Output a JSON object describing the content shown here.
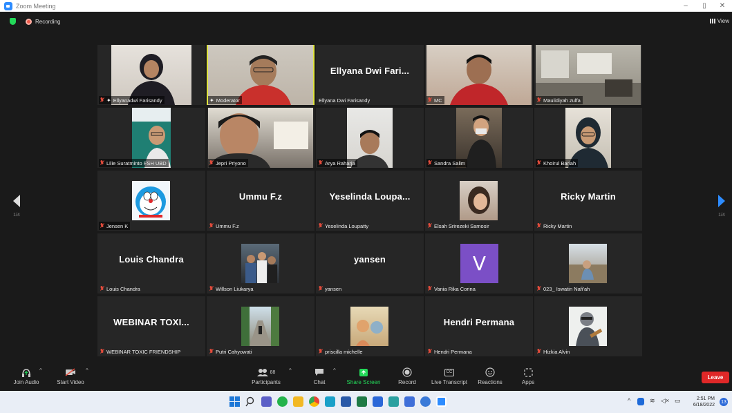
{
  "window": {
    "title": "Zoom Meeting",
    "minimize": "–",
    "restore": "▯",
    "close": "✕"
  },
  "meeting": {
    "recording_label": "Recording",
    "view_label": "View",
    "page_left": "1/4",
    "page_right": "1/4"
  },
  "tiles": [
    {
      "name": "Ellyanadwi Farisandy",
      "type": "video",
      "bg": "#d9d6d2"
    },
    {
      "name": "Moderator",
      "type": "video",
      "bg": "#c9c2b8",
      "pinned": true
    },
    {
      "name": "Ellyana Dwi Farisandy",
      "type": "text",
      "display": "Ellyana  Dwi  Fari..."
    },
    {
      "name": "MC",
      "type": "video",
      "bg": "#c9b5a8"
    },
    {
      "name": "Maulidiyah zulfa",
      "type": "video",
      "bg": "#a7a69c"
    },
    {
      "name": "Lilie Suratminto FSH UBD",
      "type": "video",
      "bg": "#2c2c2c"
    },
    {
      "name": "Jepri Priyono",
      "type": "video",
      "bg": "#6c6660"
    },
    {
      "name": "Arya Raharja",
      "type": "video",
      "bg": "#1f1f1f"
    },
    {
      "name": "Sandra Salim",
      "type": "video",
      "bg": "#3d3a36"
    },
    {
      "name": "Khoirul Bariah",
      "type": "video",
      "bg": "#2b2b2b"
    },
    {
      "name": "Jensen K",
      "type": "video",
      "bg": "#262626"
    },
    {
      "name": "Ummu F.z",
      "type": "text",
      "display": "Ummu F.z"
    },
    {
      "name": "Yeselinda Loupatty",
      "type": "text",
      "display": "Yeselinda  Loupa..."
    },
    {
      "name": "Elsah Srirezeki Samosir",
      "type": "video",
      "bg": "#262626"
    },
    {
      "name": "Ricky Martin",
      "type": "text",
      "display": "Ricky Martin"
    },
    {
      "name": "Louis Chandra",
      "type": "text",
      "display": "Louis Chandra"
    },
    {
      "name": "Willson Liukarya",
      "type": "video",
      "bg": "#262626"
    },
    {
      "name": "yansen",
      "type": "text",
      "display": "yansen"
    },
    {
      "name": "Vania Rika Corina",
      "type": "avatar",
      "letter": "V"
    },
    {
      "name": "023_ Iswatin Nafi'ah",
      "type": "video",
      "bg": "#262626"
    },
    {
      "name": "WEBINAR TOXIC FRIENDSHIP",
      "type": "text",
      "display": "WEBINAR  TOXI..."
    },
    {
      "name": "Putri Cahyowati",
      "type": "video",
      "bg": "#262626"
    },
    {
      "name": "priscilla michelle",
      "type": "video",
      "bg": "#262626"
    },
    {
      "name": "Hendri Permana",
      "type": "text",
      "display": "Hendri Permana"
    },
    {
      "name": "Hizkia Alvin",
      "type": "video",
      "bg": "#262626"
    }
  ],
  "toolbar": {
    "join_audio": "Join Audio",
    "start_video": "Start Video",
    "participants": "Participants",
    "participants_count": "88",
    "chat": "Chat",
    "share_screen": "Share Screen",
    "record": "Record",
    "live_transcript": "Live Transcript",
    "cc": "CC",
    "reactions": "Reactions",
    "apps": "Apps",
    "leave": "Leave"
  },
  "taskbar": {
    "time": "2:51 PM",
    "date": "6/18/2022",
    "notifications": "13"
  }
}
